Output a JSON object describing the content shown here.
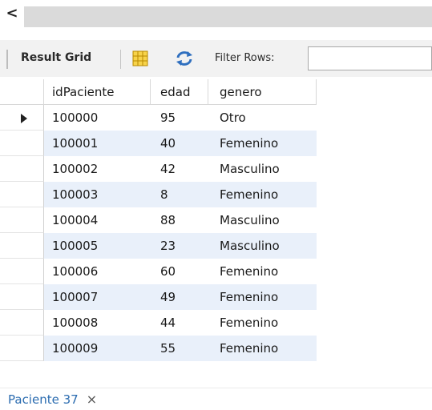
{
  "scroll": {
    "left_arrow": "<"
  },
  "toolbar": {
    "result_grid_label": "Result Grid",
    "filter_label": "Filter Rows:",
    "filter_value": ""
  },
  "grid": {
    "columns": [
      "idPaciente",
      "edad",
      "genero"
    ],
    "rows": [
      [
        "100000",
        "95",
        "Otro"
      ],
      [
        "100001",
        "40",
        "Femenino"
      ],
      [
        "100002",
        "42",
        "Masculino"
      ],
      [
        "100003",
        "8",
        "Femenino"
      ],
      [
        "100004",
        "88",
        "Masculino"
      ],
      [
        "100005",
        "23",
        "Masculino"
      ],
      [
        "100006",
        "60",
        "Femenino"
      ],
      [
        "100007",
        "49",
        "Femenino"
      ],
      [
        "100008",
        "44",
        "Femenino"
      ],
      [
        "100009",
        "55",
        "Femenino"
      ]
    ]
  },
  "tabs": [
    {
      "label": "Paciente 37",
      "close": "×"
    }
  ],
  "colors": {
    "alt_row": "#e9f0fa",
    "tab_text": "#2b6cb0",
    "toolbar_bg": "#f2f2f2"
  }
}
